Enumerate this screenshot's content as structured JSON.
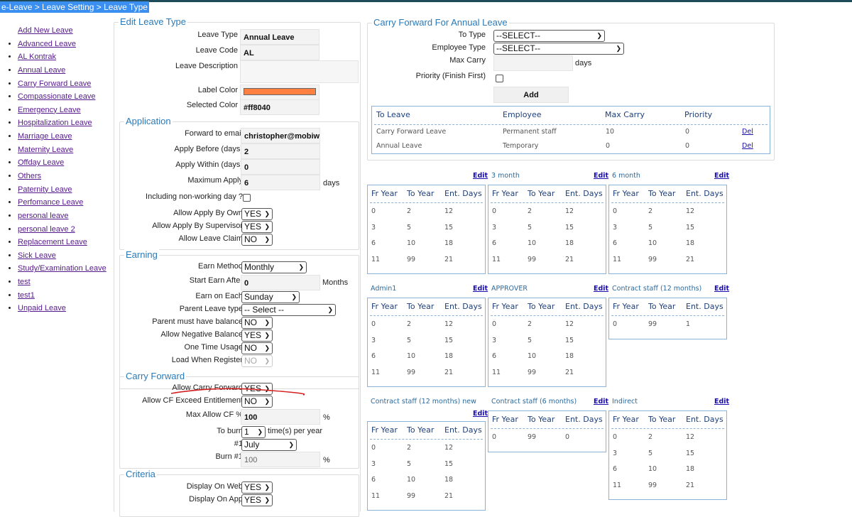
{
  "breadcrumb": "e-Leave > Leave Setting > Leave Type",
  "sidebar": {
    "add_new": "Add New Leave",
    "items": [
      "Advanced Leave",
      "AL Kontrak",
      "Annual Leave",
      "Carry Forward Leave",
      "Compassionate Leave",
      "Emergency Leave",
      "Hospitalization Leave",
      "Marriage Leave",
      "Maternity Leave",
      "Offday Leave",
      "Others",
      "Paternity Leave",
      "Perfomance Leave",
      "personal leave",
      "personal leave 2",
      "Replacement Leave",
      "Sick Leave",
      "Study/Examination Leave",
      "test",
      "test1",
      "Unpaid Leave"
    ]
  },
  "edit_leave_type": {
    "legend": "Edit Leave Type",
    "leave_type_label": "Leave Type",
    "leave_type_value": "Annual Leave",
    "leave_code_label": "Leave Code",
    "leave_code_value": "AL",
    "leave_description_label": "Leave Description",
    "leave_description_value": "",
    "label_color_label": "Label Color",
    "label_color_value": "#ff8040",
    "selected_color_label": "Selected Color",
    "selected_color_value": "#ff8040"
  },
  "application": {
    "legend": "Application",
    "forward_email_label": "Forward to email",
    "forward_email_value": "christopher@mobiwe",
    "apply_before_label": "Apply Before (days)",
    "apply_before_value": "2",
    "apply_within_label": "Apply Within (days)",
    "apply_within_value": "0",
    "maximum_apply_label": "Maximum Apply",
    "maximum_apply_value": "6",
    "maximum_apply_unit": "days",
    "non_working_label": "Including non-working day ?",
    "non_working_checked": false,
    "apply_own_label": "Allow Apply By Own",
    "apply_own_value": "YES",
    "apply_supervisor_label": "Allow Apply By Supervisor",
    "apply_supervisor_value": "YES",
    "leave_claim_label": "Allow Leave Claim",
    "leave_claim_value": "NO"
  },
  "earning": {
    "legend": "Earning",
    "earn_method_label": "Earn Method",
    "earn_method_value": "Monthly",
    "start_earn_label": "Start Earn After",
    "start_earn_value": "0",
    "start_earn_unit": "Months",
    "earn_each_label": "Earn on Each",
    "earn_each_value": "Sunday",
    "parent_type_label": "Parent Leave type",
    "parent_type_value": "-- Select --",
    "parent_balance_label": "Parent must have balance",
    "parent_balance_value": "NO",
    "negative_label": "Allow Negative Balance",
    "negative_value": "YES",
    "one_time_label": "One Time Usage",
    "one_time_value": "NO",
    "load_register_label": "Load When Register",
    "load_register_value": "NO"
  },
  "carry_forward": {
    "legend": "Carry Forward",
    "allow_cf_label": "Allow Carry Forward",
    "allow_cf_value": "YES",
    "exceed_label": "Allow CF Exceed Entitlement",
    "exceed_value": "NO",
    "max_cf_label": "Max Allow CF %",
    "max_cf_value": "100",
    "max_cf_unit": "%",
    "to_burn_label": "To burn",
    "to_burn_value": "1",
    "to_burn_unit": "time(s) per year",
    "burn1_month_label": "#1",
    "burn1_month_value": "July",
    "burn1_label": "Burn #1",
    "burn1_value": "100",
    "burn1_unit": "%"
  },
  "criteria": {
    "legend": "Criteria",
    "web_label": "Display On Web",
    "web_value": "YES",
    "app_label": "Display On App",
    "app_value": "YES"
  },
  "cf_annual": {
    "legend": "Carry Forward For Annual Leave",
    "to_type_label": "To Type",
    "to_type_value": "--SELECT--",
    "employee_type_label": "Employee Type",
    "employee_type_value": "--SELECT--",
    "max_carry_label": "Max Carry",
    "max_carry_value": "",
    "max_carry_unit": "days",
    "priority_label": "Priority (Finish First)",
    "priority_checked": false,
    "add_label": "Add",
    "table": {
      "headers": [
        "To Leave",
        "Employee",
        "Max Carry",
        "Priority"
      ],
      "rows": [
        {
          "to_leave": "Carry Forward Leave",
          "employee": "Permanent staff",
          "max_carry": "10",
          "priority": "0",
          "action": "Del"
        },
        {
          "to_leave": "Annual Leave",
          "employee": "Temporary",
          "max_carry": "0",
          "priority": "0",
          "action": "Del"
        }
      ]
    }
  },
  "entitlement": {
    "headers": [
      "Fr Year",
      "To Year",
      "Ent. Days"
    ],
    "edit_label": "Edit",
    "groups": [
      {
        "title": "",
        "rows": [
          [
            "0",
            "2",
            "12"
          ],
          [
            "3",
            "5",
            "15"
          ],
          [
            "6",
            "10",
            "18"
          ],
          [
            "11",
            "99",
            "21"
          ]
        ]
      },
      {
        "title": "3 month",
        "rows": [
          [
            "0",
            "2",
            "12"
          ],
          [
            "3",
            "5",
            "15"
          ],
          [
            "6",
            "10",
            "18"
          ],
          [
            "11",
            "99",
            "21"
          ]
        ]
      },
      {
        "title": "6 month",
        "rows": [
          [
            "0",
            "2",
            "12"
          ],
          [
            "3",
            "5",
            "15"
          ],
          [
            "6",
            "10",
            "18"
          ],
          [
            "11",
            "99",
            "21"
          ]
        ]
      },
      {
        "title": "Admin1",
        "rows": [
          [
            "0",
            "2",
            "12"
          ],
          [
            "3",
            "5",
            "15"
          ],
          [
            "6",
            "10",
            "18"
          ],
          [
            "11",
            "99",
            "21"
          ]
        ]
      },
      {
        "title": "APPROVER",
        "rows": [
          [
            "0",
            "2",
            "12"
          ],
          [
            "3",
            "5",
            "15"
          ],
          [
            "6",
            "10",
            "18"
          ],
          [
            "11",
            "99",
            "21"
          ]
        ]
      },
      {
        "title": "Contract staff (12 months)",
        "rows": [
          [
            "0",
            "99",
            "1"
          ]
        ]
      },
      {
        "title": "Contract staff (12 months) new",
        "rows": [
          [
            "0",
            "2",
            "12"
          ],
          [
            "3",
            "5",
            "15"
          ],
          [
            "6",
            "10",
            "18"
          ],
          [
            "11",
            "99",
            "21"
          ]
        ]
      },
      {
        "title": "Contract staff (6 months)",
        "rows": [
          [
            "0",
            "99",
            "0"
          ]
        ]
      },
      {
        "title": "Indirect",
        "rows": [
          [
            "0",
            "2",
            "12"
          ],
          [
            "3",
            "5",
            "15"
          ],
          [
            "6",
            "10",
            "18"
          ],
          [
            "11",
            "99",
            "21"
          ]
        ]
      }
    ]
  }
}
